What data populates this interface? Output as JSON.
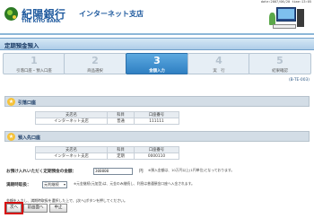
{
  "header": {
    "datetime": "date:2007/06/20 time:13:05",
    "bank_name": "紀陽銀行",
    "bank_roman": "THE KIYO BANK",
    "branch": "インターネット支店"
  },
  "page_title": "定期預金預入",
  "steps": [
    {
      "num": "1",
      "label": "引落口座・預入口座"
    },
    {
      "num": "2",
      "label": "商品選択"
    },
    {
      "num": "3",
      "label": "金額入力"
    },
    {
      "num": "4",
      "label": "実　行"
    },
    {
      "num": "5",
      "label": "結果確認"
    }
  ],
  "screen_id": "(B-TE-003)",
  "debit_section": {
    "title": "引落口座",
    "headers": [
      "支店名",
      "科目",
      "口座番号"
    ],
    "row": [
      "インターネット支店",
      "普通",
      "111111"
    ]
  },
  "deposit_section": {
    "title": "預入先口座",
    "headers": [
      "支店名",
      "科目",
      "口座番号"
    ],
    "row": [
      "インターネット支店",
      "定期",
      "0000110"
    ]
  },
  "form": {
    "amount_label": "お預け入れいただく定期預金の金額：",
    "amount_value": "300000",
    "amount_unit": "円",
    "amount_note": "※預入金額は、10万円以上(1円単位)となっております。",
    "auto_label": "満期時取扱：",
    "auto_value": "元利継続",
    "auto_note": "※元金継続(元加型)は、元金のみ継続し、利息は普通預金口座へ入金されます。"
  },
  "bottom_note": "金額を入力し、満期時取扱を選択した上で、[次へ]ボタンを押してください。",
  "buttons": {
    "next": "次へ",
    "back": "前画面へ",
    "cancel": "中止"
  }
}
